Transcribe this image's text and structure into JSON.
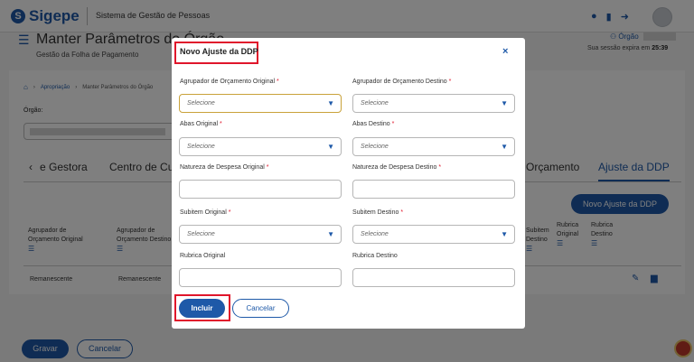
{
  "app": {
    "logo_letter": "S",
    "logo_text": "Sigepe",
    "system_name": "Sistema de Gestão de Pessoas"
  },
  "header": {
    "icons": [
      "chat-icon",
      "document-icon",
      "logout-icon"
    ],
    "orgao_tag": "Órgão",
    "title": "Manter Parâmetros do Órgão",
    "subtitle": "Gestão da Folha de Pagamento",
    "session_prefix": "Sua sessão expira em",
    "session_time": "25:39"
  },
  "breadcrumb": {
    "items": [
      "Apropriação",
      "Manter Parâmetros do Órgão"
    ]
  },
  "orgao": {
    "label": "Órgão:"
  },
  "tabs": {
    "items": [
      "e Gestora",
      "Centro de Custo",
      "Orçamento",
      "Ajuste da DDP"
    ],
    "active": "Ajuste da DDP"
  },
  "background_actions": {
    "novo_ajuste": "Novo Ajuste da DDP",
    "gravar": "Gravar",
    "cancelar": "Cancelar"
  },
  "table": {
    "headers": [
      [
        "Agrupador de",
        "Orçamento Original"
      ],
      [
        "Agrupador de",
        "Orçamento Destino"
      ],
      [
        "Subitem",
        "Destino"
      ],
      [
        "Rubrica",
        "Original"
      ],
      [
        "Rubrica",
        "Destino"
      ]
    ],
    "row": [
      "Remanescente",
      "Remanescente"
    ]
  },
  "modal": {
    "title": "Novo Ajuste da DDP",
    "close": "×",
    "required_mark": "*",
    "select_placeholder": "Selecione",
    "fields": {
      "agrupador_original": "Agrupador de Orçamento Original",
      "agrupador_destino": "Agrupador de Orçamento Destino",
      "abas_original": "Abas Original",
      "abas_destino": "Abas Destino",
      "natureza_original": "Natureza de Despesa Original",
      "natureza_destino": "Natureza de Despesa Destino",
      "subitem_original": "Subitem Original",
      "subitem_destino": "Subitem Destino",
      "rubrica_original": "Rubrica Original",
      "rubrica_destino": "Rubrica Destino"
    },
    "buttons": {
      "incluir": "Incluir",
      "cancelar": "Cancelar"
    }
  },
  "colors": {
    "primary": "#1e59a8",
    "highlight": "#e0162b",
    "required": "#e0162b"
  }
}
